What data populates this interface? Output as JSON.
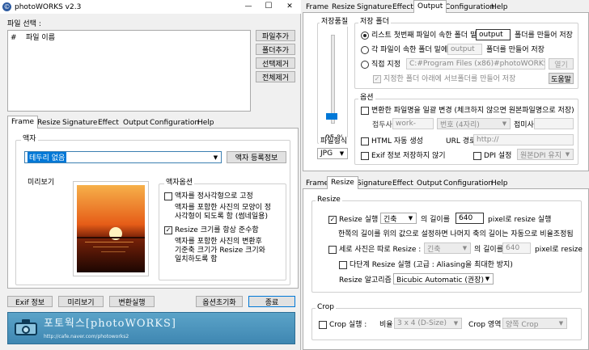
{
  "window": {
    "title": "photoWORKS v2.3",
    "logo_glyph": "©",
    "minimize": "—",
    "maximize": "☐",
    "close": "✕"
  },
  "file_select": {
    "label": "파일 선택 :",
    "col_num": "#",
    "col_name": "파일 이름",
    "buttons": [
      "파일추가",
      "폴더추가",
      "선택제거",
      "전체제거"
    ]
  },
  "left_tabs": [
    "Frame",
    "Resize",
    "Signature",
    "Effect",
    "Output",
    "Configuration",
    "Help"
  ],
  "frame": {
    "group_label": "액자",
    "select_value": "테두리 없음",
    "register_button": "액자 등록정보",
    "preview_label": "미리보기",
    "options_label": "액자옵션",
    "opt1_label": "액자를 정사각형으로 고정",
    "opt1_desc": [
      "액자를 포함한 사진의 모양이 정",
      "사각형이 되도록 함 (썸네일용)"
    ],
    "opt1_checked": false,
    "opt2_label": "Resize 크기를 항상 준수함",
    "opt2_desc": [
      "액자를 포함한 사진의 변환후",
      "기준축 크기가 Resize 크기와",
      "일치하도록 함"
    ],
    "opt2_checked": true
  },
  "bottom_buttons": {
    "exif": "Exif 정보",
    "preview": "미리보기",
    "convert": "변환실행",
    "reset": "옵션초기화",
    "exit": "종료"
  },
  "banner": {
    "title": "포토웍스[photoWORKS]",
    "url": "http://cafe.naver.com/photoworks2"
  },
  "right_top_tabs": [
    "Frame",
    "Resize",
    "Signature",
    "Effect",
    "Output",
    "Configuration",
    "Help"
  ],
  "output": {
    "quality_label": "저장품질",
    "quality_value": 95,
    "quality_text": "95 %",
    "format_label": "파일형식",
    "format_value": "JPG",
    "folder_label": "저장 폴더",
    "r1_before": "리스트 첫번째 파일이 속한 폴더 밑에",
    "r1_input": "output",
    "r1_after": "폴더를 만들어 저장",
    "r2_before": "각 파일이 속한 폴더 밑에",
    "r2_input": "output",
    "r2_after": "폴더를 만들어 저장",
    "r3_label": "직접 지정",
    "r3_path": "C:#Program Files (x86)#photoWORKS",
    "open_button": "열기",
    "subfolder_label": "지정한 폴더 아래에 서브폴더를 만들어 저장",
    "help_button": "도움말",
    "options_label": "옵션",
    "rename_label": "변환한 파일명을 일괄 변경 (체크하지 않으면 원본파일명으로 저장)",
    "prefix_label": "접두사",
    "prefix_value": "work-",
    "numbering_value": "번호 (4자리)",
    "suffix_label": "접미사",
    "html_label": "HTML 자동 생성",
    "url_label": "URL 경로",
    "url_value": "http://",
    "exif_label": "Exif 정보 저장하지 않기",
    "dpi_label": "DPI 설정",
    "dpi_value": "원본DPI 유지"
  },
  "right_bottom_tabs": [
    "Frame",
    "Resize",
    "Signature",
    "Effect",
    "Output",
    "Configuration",
    "Help"
  ],
  "resize": {
    "group_label": "Resize",
    "run_label": "Resize 실행 :",
    "axis_value": "긴축",
    "length_label": "의 길이를",
    "length_value": "640",
    "pixel_label": "pixel로 resize 실행",
    "desc": "한쪽의 길이를 위의 값으로 설정하면 나머지 축의 길이는 자동으로 비율조정됨",
    "portrait_label": "세로 사진은 따로 Resize :",
    "portrait_axis": "긴축",
    "portrait_length_label": "의 길이를",
    "portrait_value": "640",
    "portrait_pixel_label": "pixel로 resize",
    "multi_label": "다단계 Resize 실행 (고급 : Aliasing을 최대한 방지)",
    "algo_label": "Resize 알고리즘",
    "algo_value": "Bicubic Automatic (권장)"
  },
  "crop": {
    "group_label": "Crop",
    "run_label": "Crop 실행 :",
    "ratio_label": "비율",
    "ratio_value": "3 x 4 (D-Size)",
    "area_label": "Crop 영역",
    "area_value": "양쪽 Crop"
  }
}
